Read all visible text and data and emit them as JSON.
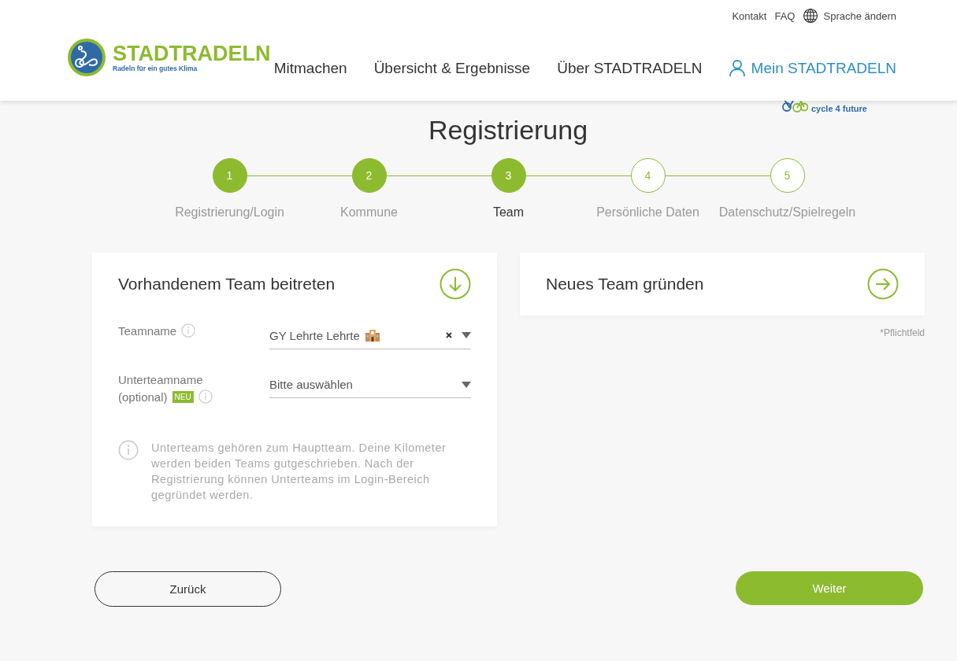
{
  "top_links": [
    {
      "label": "Kontakt"
    },
    {
      "label": "FAQ"
    },
    {
      "label": "Sprache ändern",
      "kind": "language"
    }
  ],
  "logo": {
    "name": "STADTRADELN",
    "tagline": "Radeln für ein gutes Klima"
  },
  "nav": [
    {
      "label": "Mitmachen",
      "kind": "plain"
    },
    {
      "label": "Übersicht & Ergebnisse",
      "kind": "plain"
    },
    {
      "label": "Über STADTRADELN",
      "kind": "plain"
    },
    {
      "label": "Mein STADTRADELN",
      "kind": "account"
    }
  ],
  "partner_logo": {
    "tagline": "cycle 4 future"
  },
  "title": "Registrierung",
  "steps": [
    {
      "number": "1",
      "label": "Registrierung/Login",
      "done": true,
      "selected": false
    },
    {
      "number": "2",
      "label": "Kommune",
      "done": true,
      "selected": false
    },
    {
      "number": "3",
      "label": "Team",
      "done": true,
      "selected": true
    },
    {
      "number": "4",
      "label": "Persönliche Daten",
      "done": false,
      "selected": false
    },
    {
      "number": "5",
      "label": "Datenschutz/Spielregeln",
      "done": false,
      "selected": false
    }
  ],
  "join_card": {
    "title": "Vorhandenem Team beitreten",
    "expanded": true,
    "fields": [
      {
        "label": "Teamname",
        "value": "GY Lehrte Lehrte",
        "school_icon": true,
        "clearable": true
      },
      {
        "label": "Unterteamname",
        "sublabel": "(optional)",
        "badge": "NEU",
        "value": "Bitte auswählen",
        "school_icon": false,
        "clearable": false
      }
    ],
    "note": "Unterteams gehören zum Hauptteam. Deine Kilometer werden beiden Teams gutgeschrieben. Nach der Registrierung können Unterteams im Login-Bereich gegründet werden."
  },
  "new_card": {
    "title": "Neues Team gründen",
    "expanded": false
  },
  "required_note": "*Pflichtfeld",
  "buttons": {
    "back": "Zurück",
    "next": "Weiter"
  }
}
